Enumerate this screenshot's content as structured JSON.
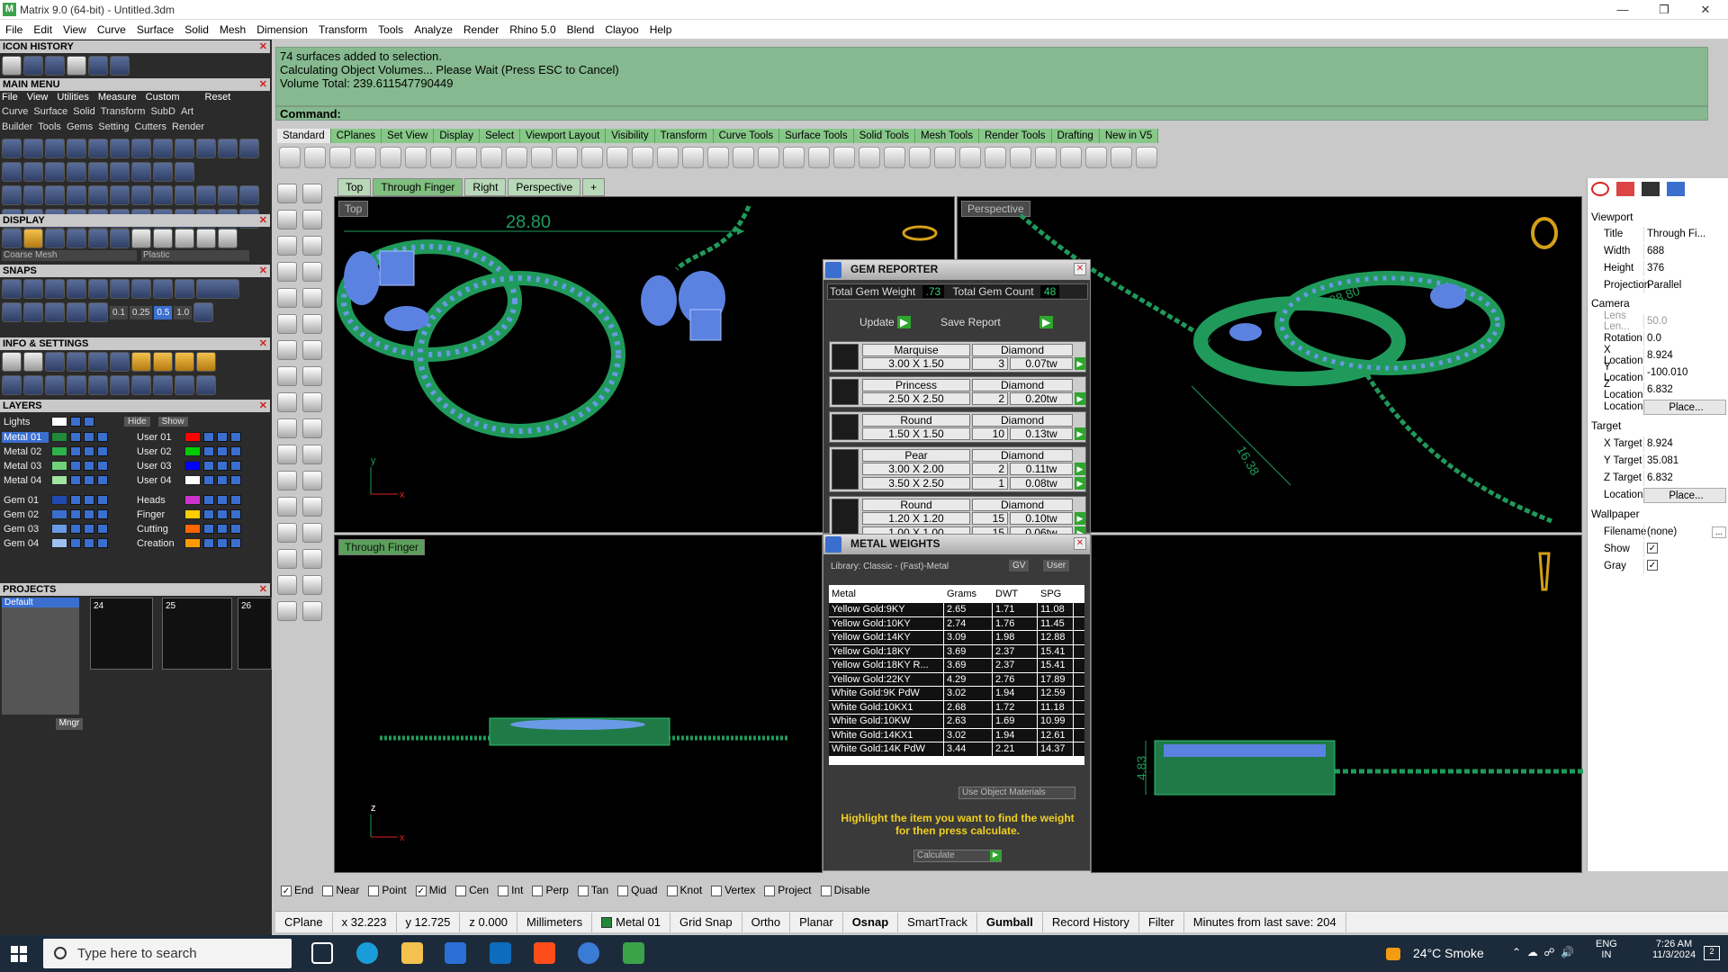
{
  "window": {
    "title": "Matrix 9.0 (64-bit) - Untitled.3dm",
    "logo": "M"
  },
  "menu": [
    "File",
    "Edit",
    "View",
    "Curve",
    "Surface",
    "Solid",
    "Mesh",
    "Dimension",
    "Transform",
    "Tools",
    "Analyze",
    "Render",
    "Rhino 5.0",
    "Blend",
    "Clayoo",
    "Help"
  ],
  "left": {
    "icon_history": "ICON HISTORY",
    "main_menu": "MAIN MENU",
    "main_menu_items": [
      "File",
      "View",
      "Utilities",
      "Measure",
      "Custom",
      "Reset"
    ],
    "main_menu_row2": [
      "Curve",
      "Surface",
      "Solid",
      "Transform",
      "SubD",
      "Art"
    ],
    "main_menu_row3": [
      "Builder",
      "Tools",
      "Gems",
      "Setting",
      "Cutters",
      "Render"
    ],
    "display": "DISPLAY",
    "display_mesh": "Coarse Mesh",
    "display_material": "Plastic",
    "snaps": "SNAPS",
    "snap_values": [
      "0.1",
      "0.25",
      "0.5",
      "1.0"
    ],
    "info": "INFO & SETTINGS",
    "layers": "LAYERS",
    "lights": "Lights",
    "hide": "Hide",
    "show": "Show",
    "layers_left": [
      "Metal 01",
      "Metal 02",
      "Metal 03",
      "Metal 04",
      "Gem 01",
      "Gem 02",
      "Gem 03",
      "Gem 04"
    ],
    "layers_right": [
      "User 01",
      "User 02",
      "User 03",
      "User 04",
      "Heads",
      "Finger",
      "Cutting",
      "Creation"
    ],
    "layer_colors_left": [
      "#1f8a3a",
      "#2fb04a",
      "#6fd27a",
      "#9fe5a0",
      "#1f4ab0",
      "#3a6fd0",
      "#6a9ae5",
      "#9fc0f0"
    ],
    "layer_colors_right": [
      "#ff0000",
      "#00cc00",
      "#0000ff",
      "#ffffff",
      "#cc33cc",
      "#ffcc00",
      "#ff6600",
      "#ff9900"
    ],
    "projects": "PROJECTS",
    "project_default": "Default",
    "project_nums": [
      "24",
      "25",
      "26"
    ],
    "mngr": "Mngr"
  },
  "command": {
    "history": [
      "74 surfaces added to selection.",
      "Calculating Object Volumes... Please Wait (Press ESC to Cancel)",
      "Volume Total: 239.611547790449"
    ],
    "prompt": "Command:"
  },
  "toolbar_tabs": [
    "Standard",
    "CPlanes",
    "Set View",
    "Display",
    "Select",
    "Viewport Layout",
    "Visibility",
    "Transform",
    "Curve Tools",
    "Surface Tools",
    "Solid Tools",
    "Mesh Tools",
    "Render Tools",
    "Drafting",
    "New in V5"
  ],
  "viewport_tabs": [
    "Top",
    "Through Finger",
    "Right",
    "Perspective",
    "+"
  ],
  "viewports": {
    "top_label": "Top",
    "persp_label": "Perspective",
    "finger_label": "Through Finger",
    "dim_top": "28.80",
    "dim_persp_a": "28.80",
    "dim_persp_b": "16.38",
    "dim_right": "4.83",
    "axis_x": "x",
    "axis_y": "y",
    "axis_z": "z"
  },
  "gem_reporter": {
    "title": "GEM REPORTER",
    "weight_label": "Total Gem Weight",
    "weight": ".73",
    "count_label": "Total Gem Count",
    "count": "48",
    "update": "Update",
    "save": "Save Report",
    "rows": [
      {
        "shape": "Marquise",
        "type": "Diamond",
        "sizes": [
          {
            "size": "3.00 X 1.50",
            "qty": "3",
            "tw": "0.07tw"
          }
        ]
      },
      {
        "shape": "Princess",
        "type": "Diamond",
        "sizes": [
          {
            "size": "2.50 X 2.50",
            "qty": "2",
            "tw": "0.20tw"
          }
        ]
      },
      {
        "shape": "Round",
        "type": "Diamond",
        "sizes": [
          {
            "size": "1.50 X 1.50",
            "qty": "10",
            "tw": "0.13tw"
          }
        ]
      },
      {
        "shape": "Pear",
        "type": "Diamond",
        "sizes": [
          {
            "size": "3.00 X 2.00",
            "qty": "2",
            "tw": "0.11tw"
          },
          {
            "size": "3.50 X 2.50",
            "qty": "1",
            "tw": "0.08tw"
          }
        ]
      },
      {
        "shape": "Round",
        "type": "Diamond",
        "sizes": [
          {
            "size": "1.20 X 1.20",
            "qty": "15",
            "tw": "0.10tw"
          },
          {
            "size": "1.00 X 1.00",
            "qty": "15",
            "tw": "0.06tw"
          }
        ]
      }
    ]
  },
  "metal_weights": {
    "title": "METAL WEIGHTS",
    "library": "Library: Classic - (Fast)-Metal",
    "gv": "GV",
    "user": "User",
    "cols": [
      "Metal",
      "Grams",
      "DWT",
      "SPG"
    ],
    "rows": [
      [
        "Yellow Gold:9KY",
        "2.65",
        "1.71",
        "11.08"
      ],
      [
        "Yellow Gold:10KY",
        "2.74",
        "1.76",
        "11.45"
      ],
      [
        "Yellow Gold:14KY",
        "3.09",
        "1.98",
        "12.88"
      ],
      [
        "Yellow Gold:18KY",
        "3.69",
        "2.37",
        "15.41"
      ],
      [
        "Yellow Gold:18KY R...",
        "3.69",
        "2.37",
        "15.41"
      ],
      [
        "Yellow Gold:22KY",
        "4.29",
        "2.76",
        "17.89"
      ],
      [
        "White Gold:9K PdW",
        "3.02",
        "1.94",
        "12.59"
      ],
      [
        "White Gold:10KX1",
        "2.68",
        "1.72",
        "11.18"
      ],
      [
        "White Gold:10KW",
        "2.63",
        "1.69",
        "10.99"
      ],
      [
        "White Gold:14KX1",
        "3.02",
        "1.94",
        "12.61"
      ],
      [
        "White Gold:14K PdW",
        "3.44",
        "2.21",
        "14.37"
      ]
    ],
    "use_obj": "Use Object Materials",
    "hint": "Highlight the item you want to find the weight for then press calculate.",
    "calculate": "Calculate"
  },
  "props": {
    "viewport": "Viewport",
    "title_k": "Title",
    "title_v": "Through Fi...",
    "width_k": "Width",
    "width_v": "688",
    "height_k": "Height",
    "height_v": "376",
    "proj_k": "Projection",
    "proj_v": "Parallel",
    "camera": "Camera",
    "lens_k": "Lens Len...",
    "lens_v": "50.0",
    "rot_k": "Rotation",
    "rot_v": "0.0",
    "xl_k": "X Location",
    "xl_v": "8.924",
    "yl_k": "Y Location",
    "yl_v": "-100.010",
    "zl_k": "Z Location",
    "zl_v": "6.832",
    "loc_k": "Location",
    "place": "Place...",
    "target": "Target",
    "xt_k": "X Target",
    "xt_v": "8.924",
    "yt_k": "Y Target",
    "yt_v": "35.081",
    "zt_k": "Z Target",
    "zt_v": "6.832",
    "wallpaper": "Wallpaper",
    "fn_k": "Filename",
    "fn_v": "(none)",
    "show_k": "Show",
    "gray_k": "Gray",
    "browse": "..."
  },
  "osnap": [
    {
      "label": "End",
      "checked": true
    },
    {
      "label": "Near",
      "checked": false
    },
    {
      "label": "Point",
      "checked": false
    },
    {
      "label": "Mid",
      "checked": true
    },
    {
      "label": "Cen",
      "checked": false
    },
    {
      "label": "Int",
      "checked": false
    },
    {
      "label": "Perp",
      "checked": false
    },
    {
      "label": "Tan",
      "checked": false
    },
    {
      "label": "Quad",
      "checked": false
    },
    {
      "label": "Knot",
      "checked": false
    },
    {
      "label": "Vertex",
      "checked": false
    },
    {
      "label": "Project",
      "checked": false
    },
    {
      "label": "Disable",
      "checked": false
    }
  ],
  "status": {
    "cplane": "CPlane",
    "x": "x 32.223",
    "y": "y 12.725",
    "z": "z 0.000",
    "units": "Millimeters",
    "layer": "Metal 01",
    "layer_color": "#1f8a3a",
    "grid": "Grid Snap",
    "ortho": "Ortho",
    "planar": "Planar",
    "osnap": "Osnap",
    "smarttrack": "SmartTrack",
    "gumball": "Gumball",
    "record": "Record History",
    "filter": "Filter",
    "save": "Minutes from last save: 204"
  },
  "taskbar": {
    "search": "Type here to search",
    "weather": "24°C  Smoke",
    "lang1": "ENG",
    "lang2": "IN",
    "time": "7:26 AM",
    "date": "11/3/2024",
    "notif": "2"
  },
  "colors": {
    "cmd_bg": "#86b98f",
    "accent_green": "#2fa52f",
    "model_green": "#1f9a5a",
    "gem_blue": "#5b82e0"
  }
}
